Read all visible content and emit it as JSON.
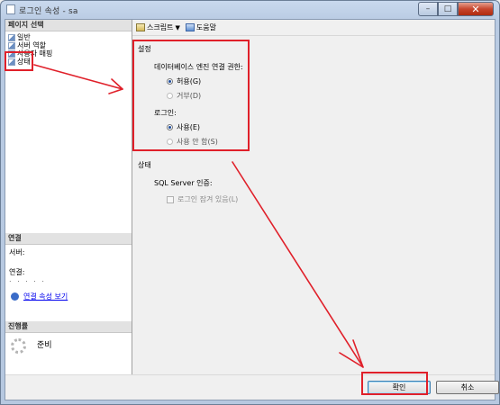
{
  "window": {
    "title": "로그인 속성 - sa",
    "min_glyph": "–",
    "max_glyph": "□",
    "close_glyph": "✕"
  },
  "left_pane": {
    "page_select_header": "페이지 선택",
    "pages": [
      {
        "label": "일반"
      },
      {
        "label": "서버 역할"
      },
      {
        "label": "사용자 매핑"
      },
      {
        "label": "상태"
      }
    ],
    "connection_header": "연결",
    "server_label": "서버:",
    "server_value": "",
    "connection_label": "연결:",
    "connection_value": ". . . . .",
    "view_connection_link": "연결 속성 보기",
    "progress_header": "진행률",
    "progress_status": "준비"
  },
  "toolbar": {
    "script_label": "스크립트",
    "dropdown_glyph": "▼",
    "help_label": "도움말"
  },
  "settings": {
    "group_title": "설정",
    "db_permission_label": "데이터베이스 엔진 연결 권한:",
    "allow_option": "허용(G)",
    "deny_option": "거부(D)",
    "login_label": "로그인:",
    "enabled_option": "사용(E)",
    "disabled_option": "사용 안 함(S)"
  },
  "status": {
    "group_title": "상태",
    "sql_auth_label": "SQL Server 인증:",
    "locked_out_label": "로그인 잠겨 있음(L)"
  },
  "buttons": {
    "ok": "확인",
    "cancel": "취소"
  },
  "annotations": {
    "highlight_color": "#e0202a"
  }
}
